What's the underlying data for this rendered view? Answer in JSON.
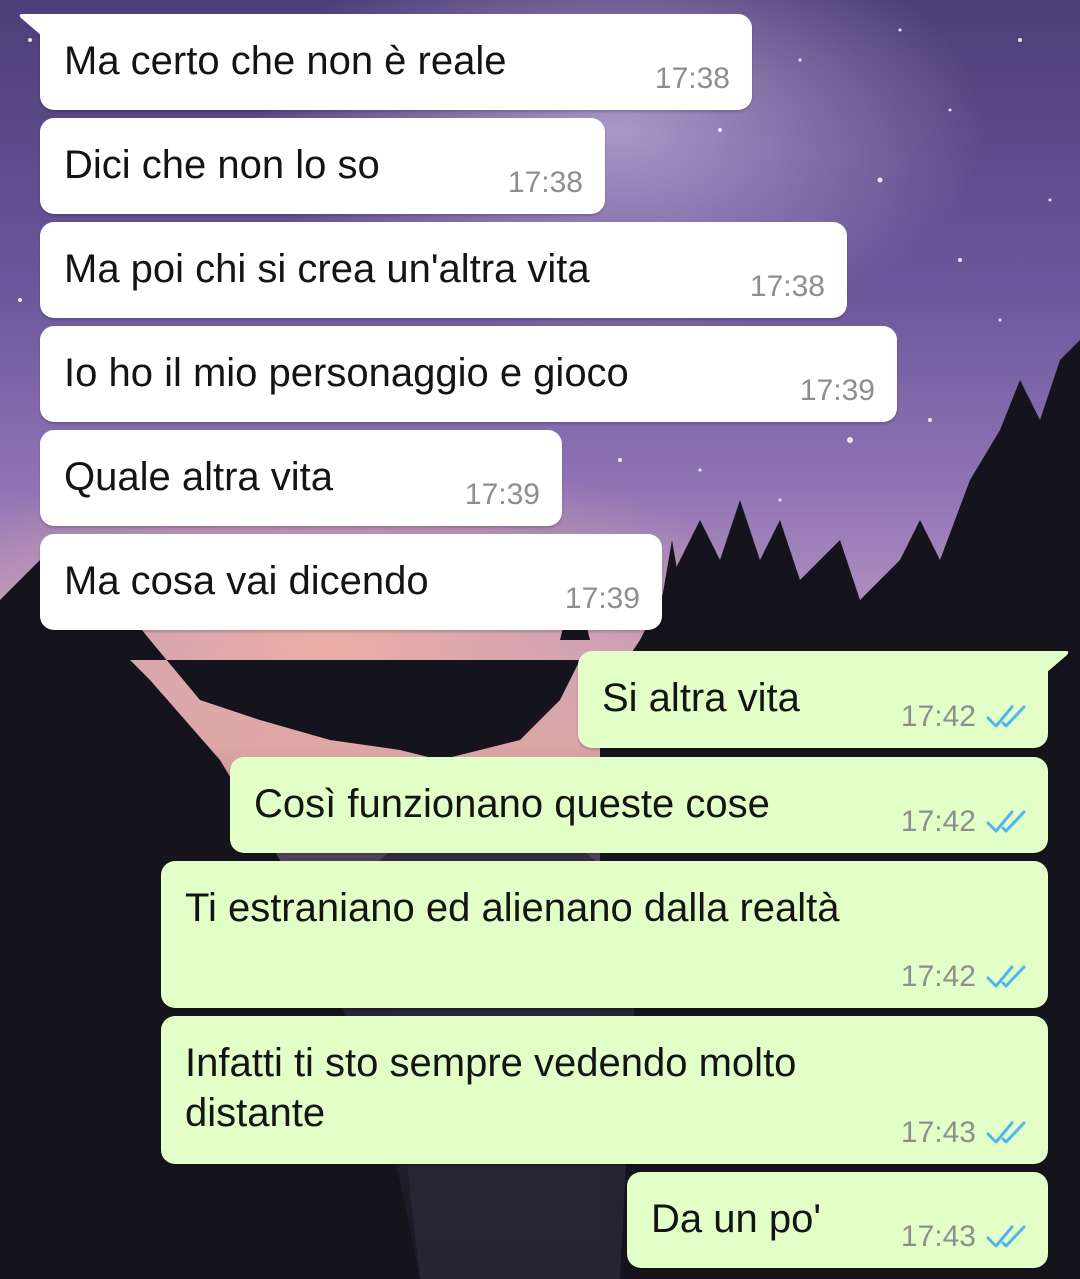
{
  "conversation": {
    "messages": [
      {
        "direction": "in",
        "text": "Ma certo che non è reale",
        "time": "17:38"
      },
      {
        "direction": "in",
        "text": "Dici che non lo so",
        "time": "17:38"
      },
      {
        "direction": "in",
        "text": "Ma poi chi si crea un'altra vita",
        "time": "17:38"
      },
      {
        "direction": "in",
        "text": "Io ho il mio personaggio e gioco",
        "time": "17:39"
      },
      {
        "direction": "in",
        "text": "Quale altra vita",
        "time": "17:39"
      },
      {
        "direction": "in",
        "text": "Ma cosa vai dicendo",
        "time": "17:39"
      },
      {
        "direction": "out",
        "text": "Si altra vita",
        "time": "17:42",
        "status": "read"
      },
      {
        "direction": "out",
        "text": "Così funzionano queste cose",
        "time": "17:42",
        "status": "read"
      },
      {
        "direction": "out",
        "text": "Ti estraniano ed alienano dalla realtà",
        "time": "17:42",
        "status": "read"
      },
      {
        "direction": "out",
        "text": "Infatti ti sto sempre vedendo molto\ndistante",
        "time": "17:43",
        "status": "read"
      },
      {
        "direction": "out",
        "text": "Da un po'",
        "time": "17:43",
        "status": "read"
      }
    ]
  },
  "icons": {
    "read_receipt": "double-check-icon"
  },
  "colors": {
    "incoming_bubble": "#ffffff",
    "outgoing_bubble": "#e2ffc7",
    "read_tick": "#4fb6ec",
    "timestamp": "#8e8e8e"
  }
}
